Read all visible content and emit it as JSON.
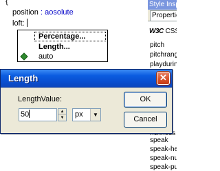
{
  "editor": {
    "lines": [
      "{",
      "position",
      "aosolute",
      "loft:"
    ]
  },
  "suggest": {
    "items": [
      "Percentage...",
      "Length...",
      "auto"
    ]
  },
  "inspector": {
    "title": "Style Inspec",
    "tab": "Properties",
    "header_logo": "W3C",
    "header_label": "CSS Lev",
    "rows": [
      "pitch",
      "pitchrange",
      "playduring",
      "richness",
      "speak",
      "speak-head",
      "speak-num",
      "speak-pun"
    ]
  },
  "dialog": {
    "title": "Length",
    "close_glyph": "✕",
    "field_label": "LengthValue:",
    "value": "50",
    "unit": "px",
    "ok_label": "OK",
    "cancel_label": "Cancel"
  }
}
